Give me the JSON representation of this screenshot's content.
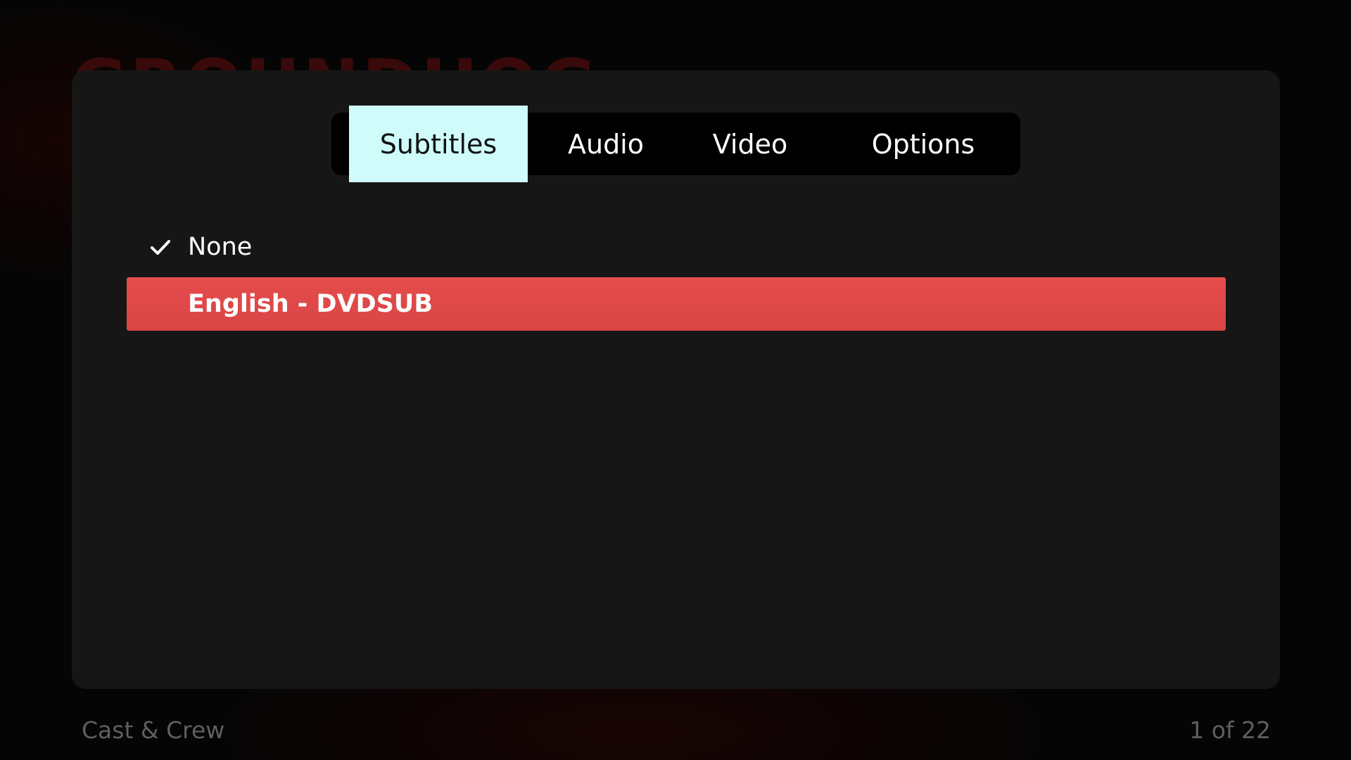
{
  "background": {
    "title_fragment": "GROUNDHOG"
  },
  "tabs": [
    {
      "label": "Subtitles",
      "active": true
    },
    {
      "label": "Audio",
      "active": false
    },
    {
      "label": "Video",
      "active": false
    },
    {
      "label": "Options",
      "active": false
    }
  ],
  "subtitle_options": [
    {
      "label": "None",
      "checked": true,
      "focused": false
    },
    {
      "label": "English - DVDSUB",
      "checked": false,
      "focused": true
    }
  ],
  "footer": {
    "left": "Cast & Crew",
    "right": "1 of 22"
  },
  "colors": {
    "active_tab_bg": "#cffbfb",
    "focus_bg": "#e04a4a",
    "dialog_bg": "#161616"
  },
  "icons": {
    "checked": "checkmark-icon"
  }
}
